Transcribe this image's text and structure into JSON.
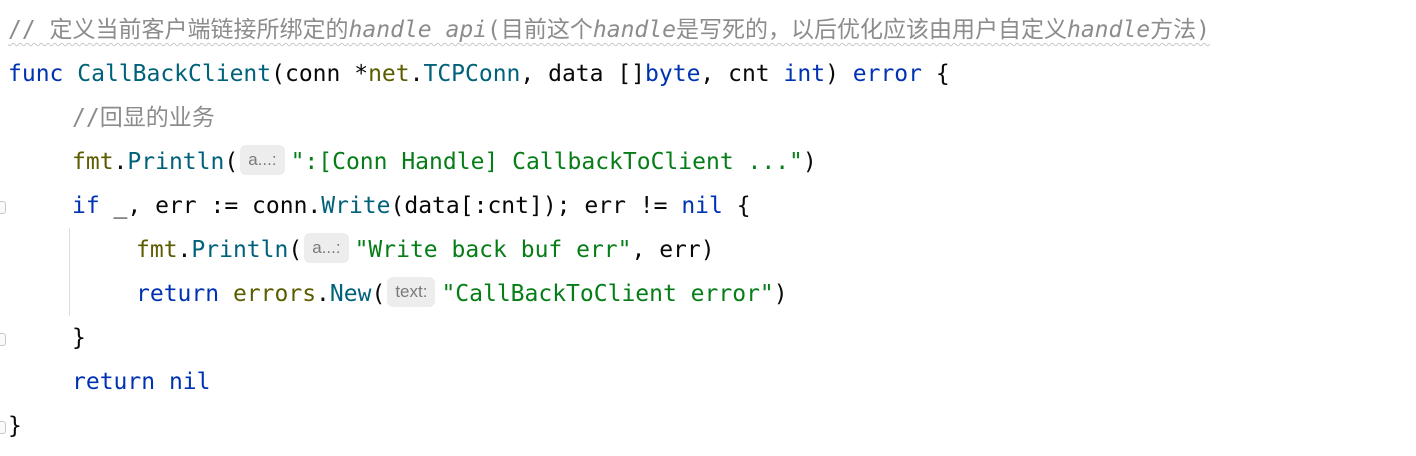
{
  "comment_line": {
    "prefix": "// ",
    "text_1": "定义当前客户端链接所绑定的",
    "italic_1": "handle api",
    "text_2": "(目前这个",
    "italic_2": "handle",
    "text_3": "是写死的，以后优化应该由用户自定义",
    "italic_3": "handle",
    "text_4": "方法)"
  },
  "func_line": {
    "kw_func": "func",
    "name": "CallBackClient",
    "open": "(conn *",
    "pkg": "net",
    "dot": ".",
    "type": "TCPConn",
    "mid": ", data []",
    "kw_byte": "byte",
    "mid2": ", cnt ",
    "kw_int": "int",
    "close": ") ",
    "kw_error": "error",
    "brace": " {"
  },
  "comment2": {
    "text": "//回显的业务"
  },
  "println1": {
    "pkg": "fmt",
    "dot": ".",
    "fn": "Println",
    "open": "(",
    "hint": "a...:",
    "str": "\":[Conn Handle] CallbackToClient ...\"",
    "close": ")"
  },
  "if_line": {
    "kw_if": "if",
    "a": " _, err := conn.",
    "fn": "Write",
    "b": "(data[:cnt]); err != ",
    "kw_nil": "nil",
    "c": " {"
  },
  "println2": {
    "pkg": "fmt",
    "dot": ".",
    "fn": "Println",
    "open": "(",
    "hint": "a...:",
    "str": "\"Write back buf err\"",
    "close": ", err)"
  },
  "return1": {
    "kw_return": "return",
    "sp": " ",
    "pkg": "errors",
    "dot": ".",
    "fn": "New",
    "open": "(",
    "hint": "text:",
    "str": "\"CallBackToClient error\"",
    "close": ")"
  },
  "close_if": {
    "text": "}"
  },
  "return2": {
    "kw_return": "return",
    "sp": " ",
    "kw_nil": "nil"
  },
  "close_func": {
    "text": "}"
  },
  "colors": {
    "keyword": "#0033b3",
    "function": "#00627a",
    "package": "#5c5c00",
    "string": "#067d17",
    "comment": "#8c8c8c",
    "hint_bg": "#ededed"
  }
}
